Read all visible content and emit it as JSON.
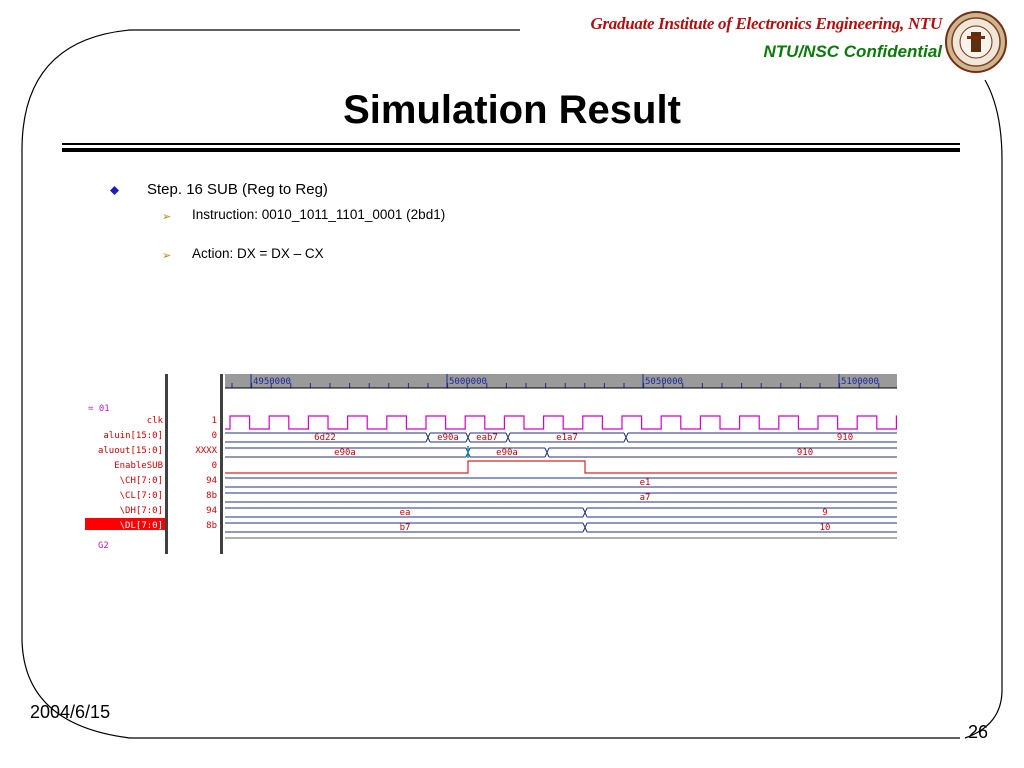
{
  "header": {
    "institute": "Graduate Institute of Electronics Engineering, NTU",
    "confidential": "NTU/NSC Confidential",
    "seal_icon": "university-seal-icon"
  },
  "slide": {
    "title": "Simulation Result",
    "bullet": "Step. 16  SUB (Reg to Reg)",
    "sub_bullets": [
      "Instruction:  0010_1011_1101_0001  (2bd1)",
      "Action: DX = DX – CX"
    ]
  },
  "footer": {
    "date": "2004/6/15",
    "page": "26"
  },
  "waveform": {
    "cursor_label": "= 01",
    "group_label": "G2",
    "time_ticks": [
      "4950000",
      "5000000",
      "5050000",
      "5100000"
    ],
    "signals": [
      {
        "name": "clk",
        "value": "1",
        "type": "clock"
      },
      {
        "name": "aluin[15:0]",
        "value": "0",
        "type": "bus",
        "segments": [
          "6d22",
          "e90a",
          "eab7",
          "e1a7",
          "910"
        ]
      },
      {
        "name": "aluout[15:0]",
        "value": "XXXX",
        "type": "bus",
        "segments": [
          "e90a",
          "e90a",
          "910"
        ]
      },
      {
        "name": "EnableSUB",
        "value": "0",
        "type": "pulse"
      },
      {
        "name": "\\CH[7:0]",
        "value": "94",
        "type": "bus",
        "segments": [
          "e1"
        ]
      },
      {
        "name": "\\CL[7:0]",
        "value": "8b",
        "type": "bus",
        "segments": [
          "a7"
        ]
      },
      {
        "name": "\\DH[7:0]",
        "value": "94",
        "type": "bus",
        "segments": [
          "ea",
          "9"
        ]
      },
      {
        "name": "\\DL[7:0]",
        "value": "8b",
        "type": "bus",
        "segments": [
          "b7",
          "10"
        ],
        "selected": true
      }
    ],
    "colors": {
      "signal_text": "#d00000",
      "selected_bg": "#ff0000",
      "clock": "#d000d0",
      "bus": "#203080",
      "pulse": "#e02020",
      "ruler_bg": "#9a9a9a",
      "ruler_text": "#1a2aa0",
      "label_misc": "#c020c0"
    }
  }
}
